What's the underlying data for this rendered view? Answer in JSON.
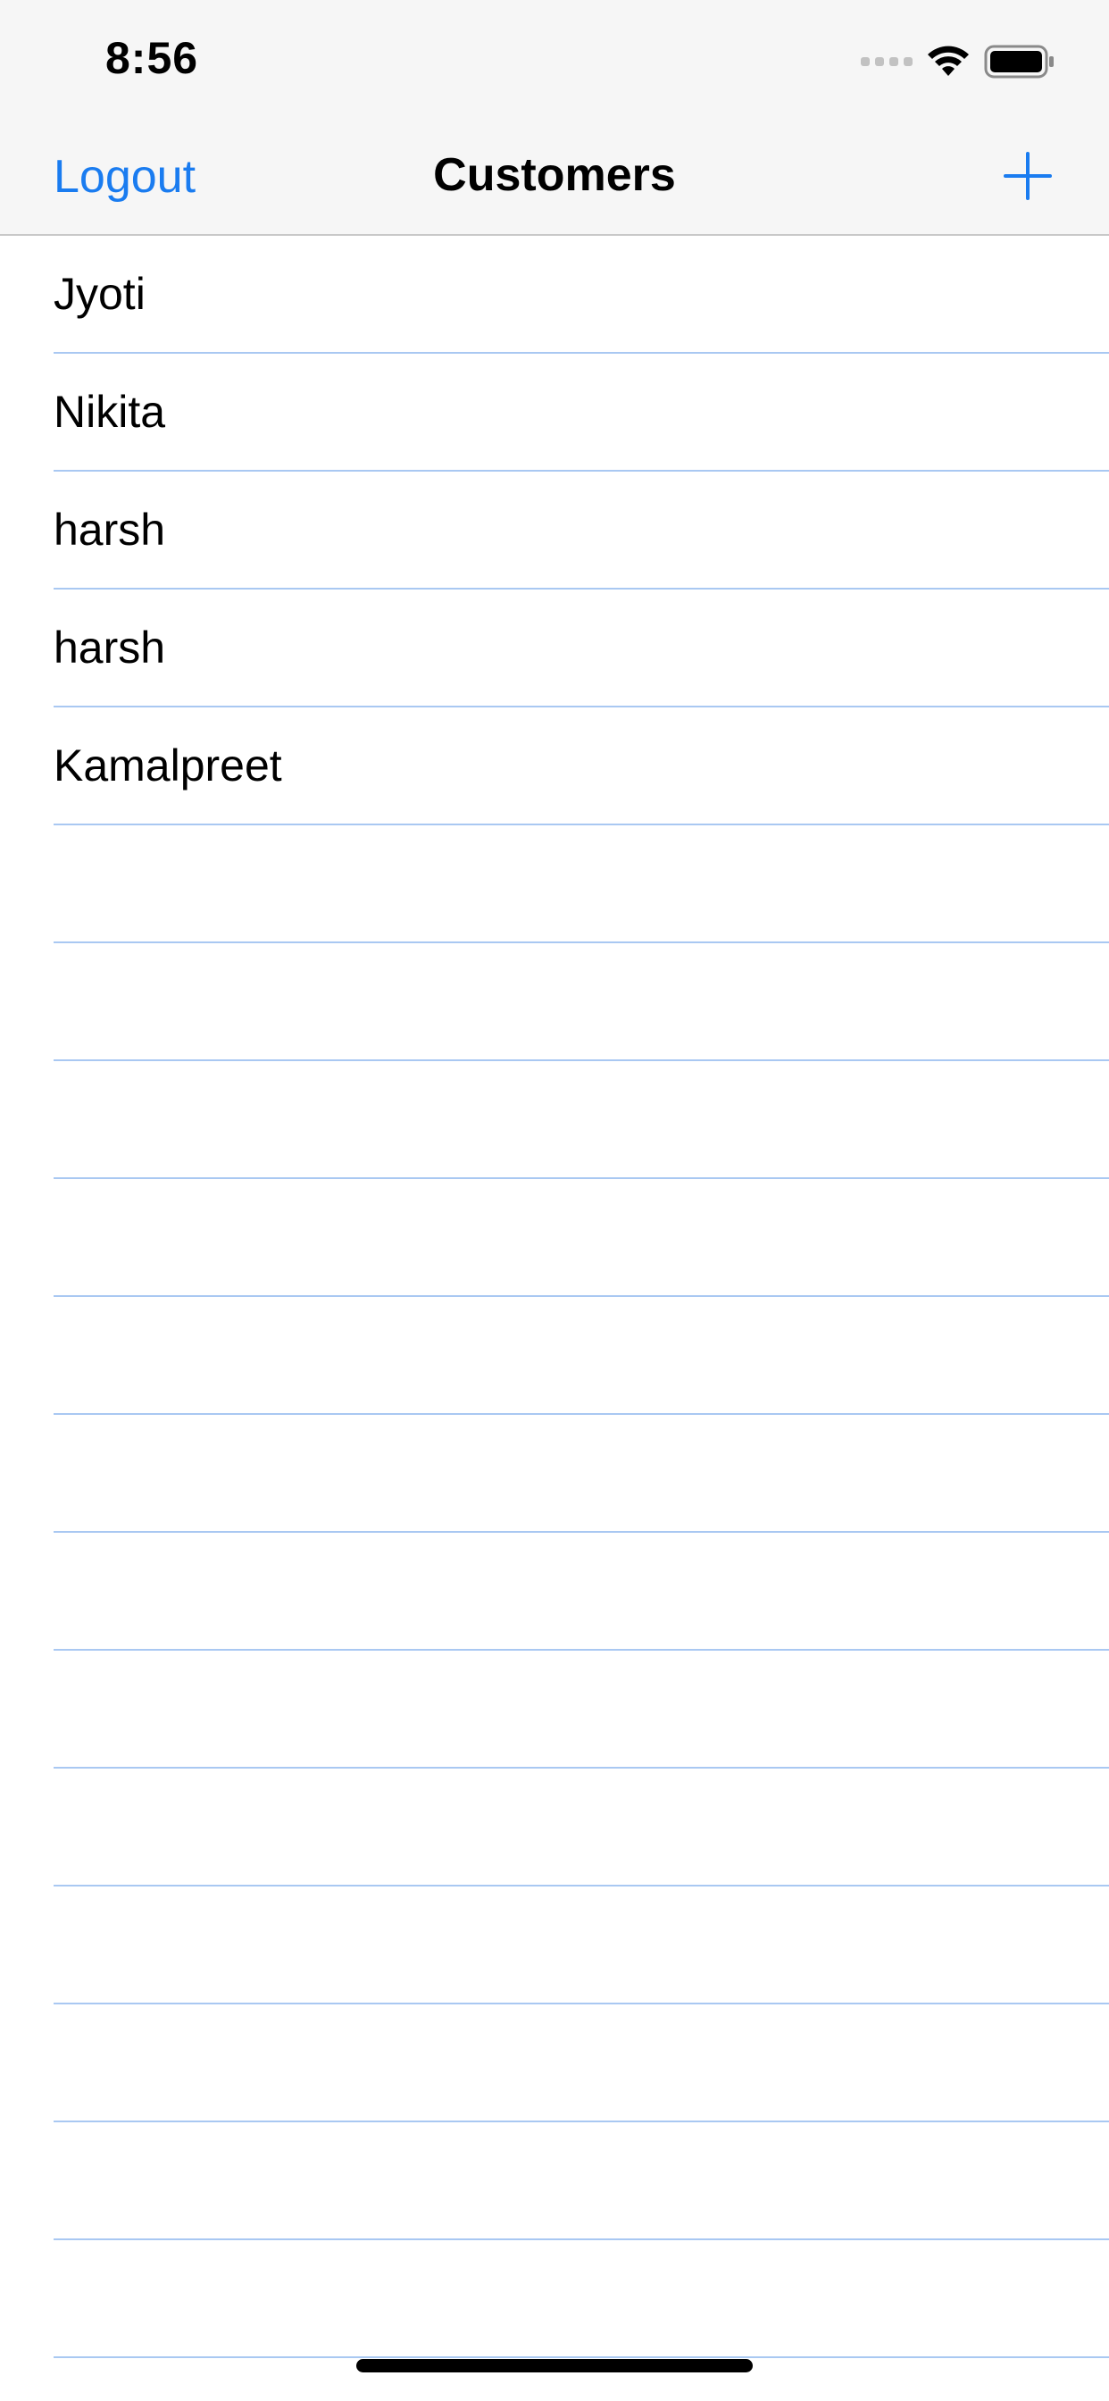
{
  "status_bar": {
    "time": "8:56"
  },
  "nav": {
    "left_label": "Logout",
    "title": "Customers",
    "add_icon": "plus-icon"
  },
  "customers": [
    "Jyoti",
    "Nikita",
    "harsh",
    "harsh",
    "Kamalpreet"
  ],
  "colors": {
    "accent": "#1a7cf0",
    "separator": "#a9c8f2",
    "bar_background": "#f6f6f6"
  }
}
